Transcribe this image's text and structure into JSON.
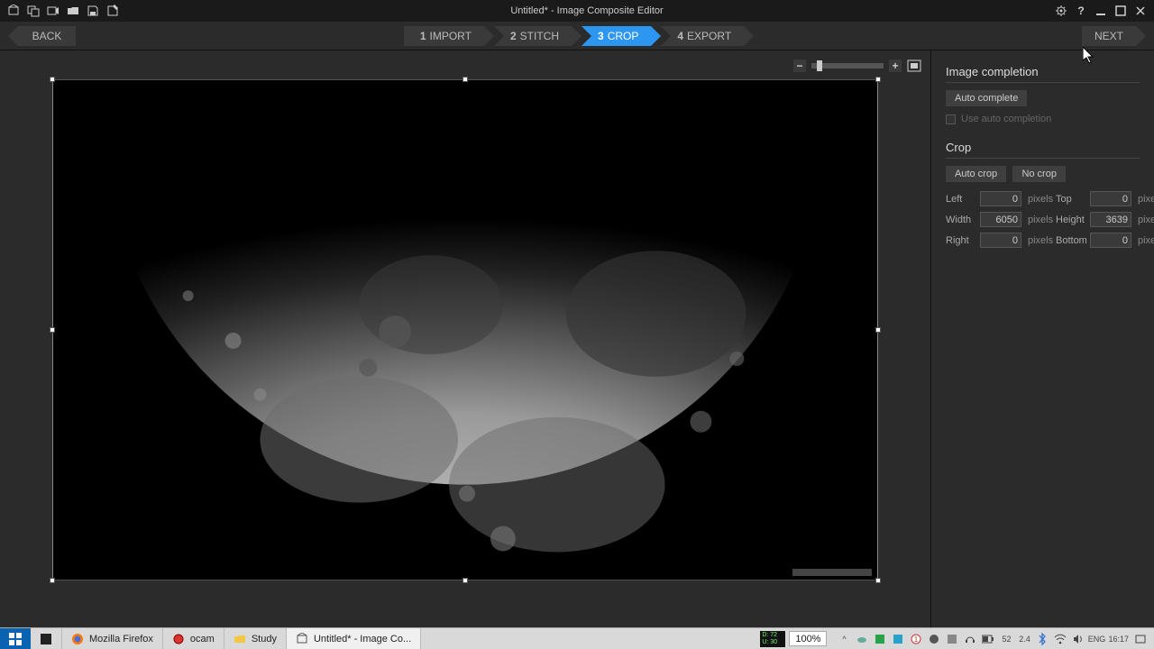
{
  "titlebar": {
    "title": "Untitled* - Image Composite Editor"
  },
  "stepbar": {
    "back": "BACK",
    "next": "NEXT",
    "steps": [
      {
        "num": "1",
        "label": "IMPORT"
      },
      {
        "num": "2",
        "label": "STITCH"
      },
      {
        "num": "3",
        "label": "CROP"
      },
      {
        "num": "4",
        "label": "EXPORT"
      }
    ]
  },
  "panel": {
    "image_completion": {
      "title": "Image completion",
      "auto_complete": "Auto complete",
      "use_auto": "Use auto completion"
    },
    "crop": {
      "title": "Crop",
      "auto_crop": "Auto crop",
      "no_crop": "No crop",
      "left_label": "Left",
      "left_value": "0",
      "top_label": "Top",
      "top_value": "0",
      "width_label": "Width",
      "width_value": "6050",
      "height_label": "Height",
      "height_value": "3639",
      "right_label": "Right",
      "right_value": "0",
      "bottom_label": "Bottom",
      "bottom_value": "0",
      "unit": "pixels"
    }
  },
  "taskbar": {
    "items": {
      "firefox": "Mozilla Firefox",
      "ocam": "ocam",
      "study": "Study",
      "ice": "Untitled* - Image Co..."
    },
    "meter": {
      "l1": "D: 72",
      "l2": "U: 30"
    },
    "zoom": "100%",
    "tray": {
      "temp": "52",
      "freq": "2.4",
      "lang": "ENG",
      "time": "16:17"
    }
  }
}
